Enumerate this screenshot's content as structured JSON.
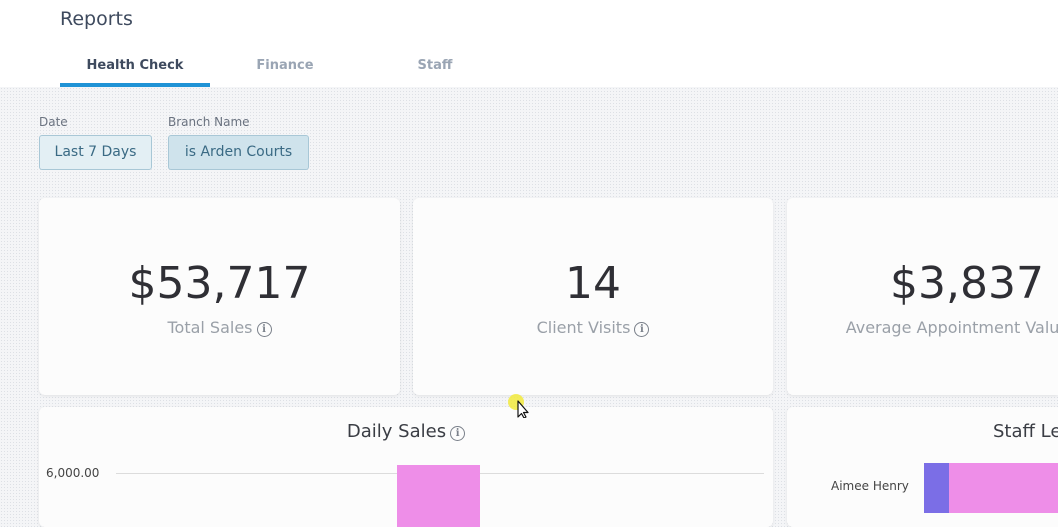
{
  "header": {
    "title": "Reports",
    "tabs": [
      {
        "label": "Health Check",
        "active": true
      },
      {
        "label": "Finance",
        "active": false
      },
      {
        "label": "Staff",
        "active": false
      }
    ]
  },
  "filters": {
    "date": {
      "label": "Date",
      "value": "Last 7 Days"
    },
    "branch": {
      "label": "Branch Name",
      "value": "is Arden Courts"
    }
  },
  "kpis": [
    {
      "value": "$53,717",
      "label": "Total Sales",
      "icon": "info-icon"
    },
    {
      "value": "14",
      "label": "Client Visits",
      "icon": "info-icon"
    },
    {
      "value": "$3,837",
      "label": "Average Appointment Value",
      "icon": "info-icon"
    }
  ],
  "daily_sales": {
    "title": "Daily Sales",
    "tick": "6,000.00",
    "bar_color": "#ee8ee8"
  },
  "staff_leaderboard": {
    "title": "Staff Leaderboard",
    "rows": [
      {
        "name": "Aimee Henry"
      }
    ],
    "segment_colors": [
      "#7b6ee6",
      "#ee8ee8"
    ]
  },
  "colors": {
    "accent": "#1f93d6",
    "cursor_highlight": "#f2ea3c"
  }
}
